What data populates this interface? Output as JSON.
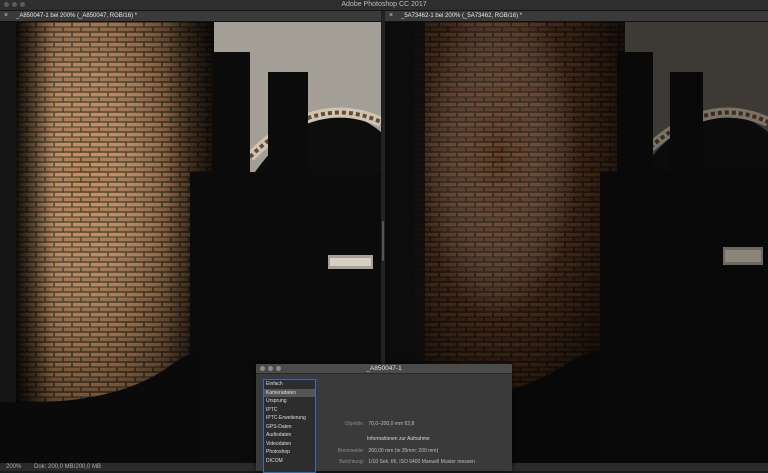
{
  "app": {
    "title": "Adobe Photoshop CC 2017"
  },
  "tabs": {
    "left": {
      "close": "×",
      "label": "_A850047-1 bei 200% (_A850047, RGB/16) *"
    },
    "right": {
      "close": "×",
      "label": "_5A73462-1 bei 200% (_5A73462, RGB/16) *"
    }
  },
  "status": {
    "zoom": "200%",
    "doc": "Dok: 200,0 MB/200,0 MB"
  },
  "dialog": {
    "title": "_A850047-1",
    "categories": [
      "Einfach",
      "Kameradaten",
      "Ursprung",
      "IPTC",
      "IPTC-Erweiterung",
      "GPS-Daten",
      "Audiodaten",
      "Videodaten",
      "Photoshop",
      "DICOM"
    ],
    "selected_index": 1,
    "objektiv_label": "Objektiv:",
    "objektiv_value": "70,0–200,0 mm f/2,8",
    "section_heading": "Informationen zur Aufnahme",
    "brennweite_label": "Brennweite:",
    "brennweite_value": "200,00 mm   (in 35mm: 200 mm)",
    "belichtung_label": "Belichtung:",
    "belichtung_value": "1/10 Sek.    f/6,  ISO 6400   Manuell    Muster messen"
  },
  "colors": {
    "brick_warm": "#c98a5c",
    "brick_dim": "#6b3e22",
    "mortar_green": "#3f4f3a",
    "wall_light": "#c9c3b7",
    "silhouette": "#0b0b0b",
    "dialog_accent": "#2f6fb5"
  }
}
